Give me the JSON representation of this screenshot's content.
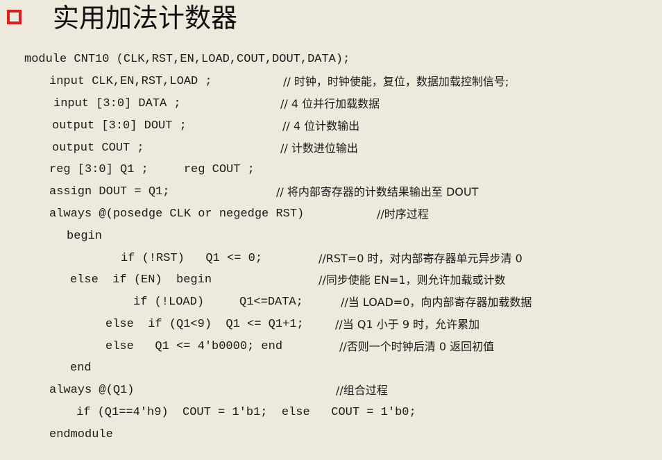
{
  "title": "实用加法计数器",
  "code_lines": [
    "module CNT10 (CLK,RST,EN,LOAD,COUT,DOUT,DATA);",
    "input CLK,EN,RST,LOAD ;",
    "input [3:0] DATA ;",
    "output [3:0] DOUT ;",
    "output COUT ;",
    "reg [3:0] Q1 ;     reg COUT ;",
    "assign DOUT = Q1;",
    "always @(posedge CLK or negedge RST)",
    "begin",
    "if (!RST)   Q1 <= 0;",
    "else  if (EN)  begin",
    "if (!LOAD)     Q1<=DATA;",
    "else  if (Q1<9)  Q1 <= Q1+1;",
    "else   Q1 <= 4'b0000; end",
    "end",
    "always @(Q1)",
    "if (Q1==4'h9)  COUT = 1'b1;  else   COUT = 1'b0;",
    "endmodule"
  ],
  "comments": [
    "// 时钟，时钟使能，复位，数据加载控制信号;",
    "// 4 位并行加载数据",
    "// 4 位计数输出",
    "// 计数进位输出",
    "// 将内部寄存器的计数结果输出至 DOUT",
    "//时序过程",
    "//RST=0 时，对内部寄存器单元异步清 0",
    "//同步使能 EN=1，则允许加载或计数",
    "//当 LOAD=0，向内部寄存器加载数据",
    "//当 Q1 小于 9 时，允许累加",
    "//否则一个时钟后清 0 返回初值",
    "//组合过程"
  ]
}
